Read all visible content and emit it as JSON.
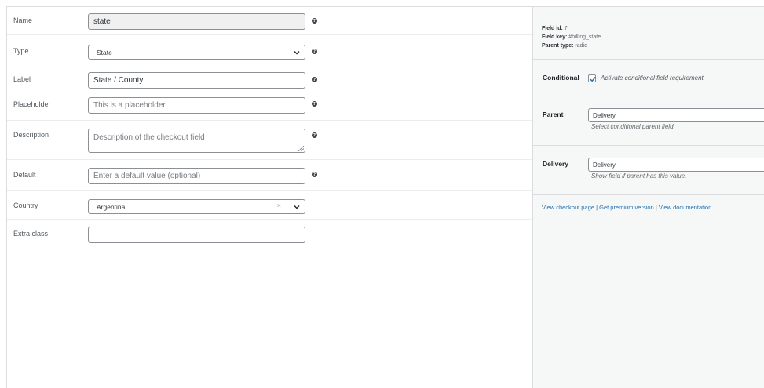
{
  "form": {
    "name": {
      "label": "Name",
      "value": "state"
    },
    "type": {
      "label": "Type",
      "value": "State"
    },
    "label": {
      "label": "Label",
      "value": "State / County"
    },
    "placeholder": {
      "label": "Placeholder",
      "placeholder": "This is a placeholder"
    },
    "description": {
      "label": "Description",
      "placeholder": "Description of the checkout field"
    },
    "default": {
      "label": "Default",
      "placeholder": "Enter a default value (optional)"
    },
    "country": {
      "label": "Country",
      "value": "Argentina",
      "clear": "×"
    },
    "extra_class": {
      "label": "Extra class",
      "value": ""
    },
    "help_glyph": "?"
  },
  "sidebar": {
    "field_id_label": "Field id:",
    "field_id_value": "7",
    "field_key_label": "Field key:",
    "field_key_value": "#billing_state",
    "parent_type_label": "Parent type:",
    "parent_type_value": "radio",
    "conditional_label": "Conditional",
    "conditional_text": "Activate conditional field requirement.",
    "conditional_checked": true,
    "parent_label": "Parent",
    "parent_value": "Delivery",
    "parent_hint": "Select conditional parent field.",
    "delivery_label": "Delivery",
    "delivery_value": "Delivery",
    "delivery_hint": "Show field if parent has this value.",
    "links": {
      "view_checkout": "View checkout page",
      "premium": "Get premium version",
      "docs": "View documentation",
      "sep": " | "
    }
  }
}
